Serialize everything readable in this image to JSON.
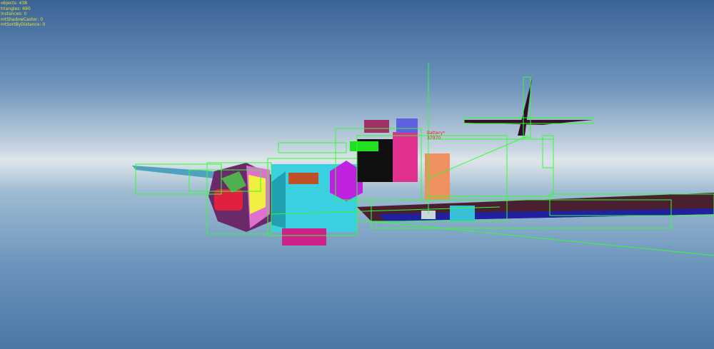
{
  "stats": {
    "objects": "objects: 438",
    "triangles": "triangles: 690",
    "instances": "instances: 0",
    "shadow_caster": "mtShadowCaster: 0",
    "sort_by_distance": "mtSortByDistance: 0"
  },
  "object_label": {
    "name": "Battery*",
    "id": "37970"
  }
}
